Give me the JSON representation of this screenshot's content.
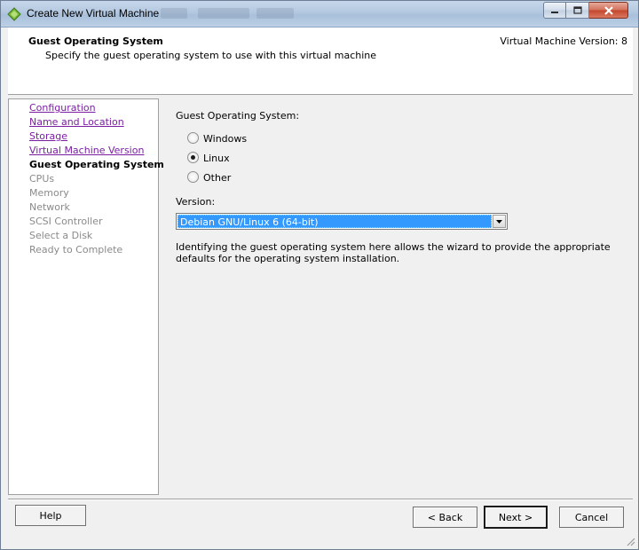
{
  "window": {
    "title": "Create New Virtual Machine",
    "title_ghost_tabs": [
      "Nexe",
      "ComeCrsk",
      "Storage"
    ]
  },
  "header": {
    "title": "Guest Operating System",
    "subtitle": "Specify the guest operating system to use with this virtual machine",
    "version_label": "Virtual Machine Version: 8"
  },
  "nav": {
    "items": [
      {
        "label": "Configuration",
        "state": "done"
      },
      {
        "label": "Name and Location",
        "state": "done"
      },
      {
        "label": "Storage",
        "state": "done"
      },
      {
        "label": "Virtual Machine Version",
        "state": "done"
      },
      {
        "label": "Guest Operating System",
        "state": "current"
      },
      {
        "label": "CPUs",
        "state": "pending"
      },
      {
        "label": "Memory",
        "state": "pending"
      },
      {
        "label": "Network",
        "state": "pending"
      },
      {
        "label": "SCSI Controller",
        "state": "pending"
      },
      {
        "label": "Select a Disk",
        "state": "pending"
      },
      {
        "label": "Ready to Complete",
        "state": "pending"
      }
    ]
  },
  "content": {
    "os_label": "Guest Operating System:",
    "os_options": [
      {
        "label": "Windows",
        "checked": false
      },
      {
        "label": "Linux",
        "checked": true
      },
      {
        "label": "Other",
        "checked": false
      }
    ],
    "version_label": "Version:",
    "version_value": "Debian GNU/Linux 6 (64-bit)",
    "description": "Identifying the guest operating system here allows the wizard to provide the appropriate defaults for the operating system installation."
  },
  "footer": {
    "help_label": "Help",
    "back_label": "< Back",
    "next_label": "Next >",
    "cancel_label": "Cancel"
  },
  "icons": {
    "app": "vsphere-icon",
    "minimize": "minimize-icon",
    "maximize": "maximize-icon",
    "close": "close-icon",
    "dropdown": "chevron-down-icon",
    "resize": "resize-grip-icon"
  },
  "colors": {
    "selection": "#3399ff",
    "visited_link": "#7b1ea2",
    "disabled_text": "#8a8a8a"
  }
}
